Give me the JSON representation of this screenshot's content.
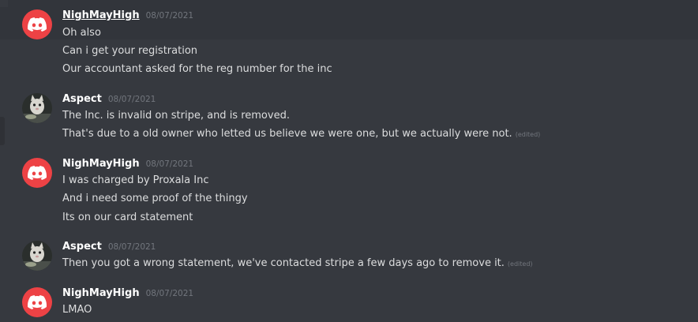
{
  "messages": [
    {
      "username": "NighMayHigh",
      "timestamp": "08/07/2021",
      "avatar": "discord-logo-icon",
      "lines": [
        {
          "text": "Oh also",
          "edited": ""
        },
        {
          "text": "Can i get your registration",
          "edited": ""
        },
        {
          "text": "Our accountant asked for the reg number for the inc",
          "edited": ""
        }
      ]
    },
    {
      "username": "Aspect",
      "timestamp": "08/07/2021",
      "avatar": "cat-photo",
      "lines": [
        {
          "text": "The Inc. is invalid on stripe, and is removed.",
          "edited": ""
        },
        {
          "text": "That's due to a old owner who letted us believe we were one, but we actually were not.",
          "edited": "(edited)"
        }
      ]
    },
    {
      "username": "NighMayHigh",
      "timestamp": "08/07/2021",
      "avatar": "discord-logo-icon",
      "lines": [
        {
          "text": "I was charged by Proxala Inc",
          "edited": ""
        },
        {
          "text": "And i need some proof of the thingy",
          "edited": ""
        },
        {
          "text": "Its on our card statement",
          "edited": ""
        }
      ]
    },
    {
      "username": "Aspect",
      "timestamp": "08/07/2021",
      "avatar": "cat-photo",
      "lines": [
        {
          "text": "Then you got a wrong statement, we've contacted stripe a few days ago to remove it.",
          "edited": "(edited)"
        }
      ]
    },
    {
      "username": "NighMayHigh",
      "timestamp": "08/07/2021",
      "avatar": "discord-logo-icon",
      "lines": [
        {
          "text": "LMAO",
          "edited": ""
        }
      ]
    }
  ],
  "colors": {
    "background": "#36393f",
    "hover": "#32353b",
    "discord_red": "#ed4245",
    "username": "#ffffff",
    "timestamp": "#72767d",
    "text": "#dcddde"
  }
}
